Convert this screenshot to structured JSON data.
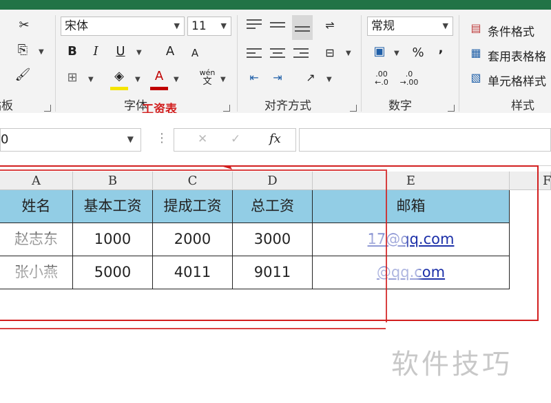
{
  "ribbon": {
    "clipboard_label": "粘贴板",
    "font_group_label": "字体",
    "font_name": "宋体",
    "font_size": "11",
    "bold": "B",
    "italic": "I",
    "underline": "U",
    "grow_font": "A",
    "shrink_font": "A",
    "font_color": "A",
    "phonetic_top": "wén",
    "phonetic_bottom": "文",
    "align_group_label": "对齐方式",
    "number_group_label": "数字",
    "number_format": "常规",
    "percent": "%",
    "comma": ",",
    "dec_increase": ".00",
    "dec_decrease": ".0",
    "style_group_label": "样式",
    "conditional_format": "条件格式",
    "format_as_table": "套用表格格",
    "cell_styles": "单元格样式"
  },
  "annotation": {
    "title": "工资表",
    "color": "#d21e1e"
  },
  "formula_bar": {
    "name_box": "0",
    "fx": "fx",
    "cancel": "✕",
    "enter": "✓"
  },
  "columns": [
    "A",
    "B",
    "C",
    "D",
    "E",
    "F"
  ],
  "table": {
    "headers": [
      "姓名",
      "基本工资",
      "提成工资",
      "总工资",
      "邮箱"
    ],
    "rows": [
      {
        "name": "赵志东",
        "base": "1000",
        "commission": "2000",
        "total": "3000",
        "email": "17@qq.com"
      },
      {
        "name": "张小燕",
        "base": "5000",
        "commission": "4011",
        "total": "9011",
        "email": "@qq.com"
      }
    ]
  },
  "watermark": "软件技巧",
  "colors": {
    "header_fill": "#92cde5",
    "excel_green": "#217346",
    "frame_red": "#d21e1e",
    "email_link": "#1b2fa8"
  }
}
